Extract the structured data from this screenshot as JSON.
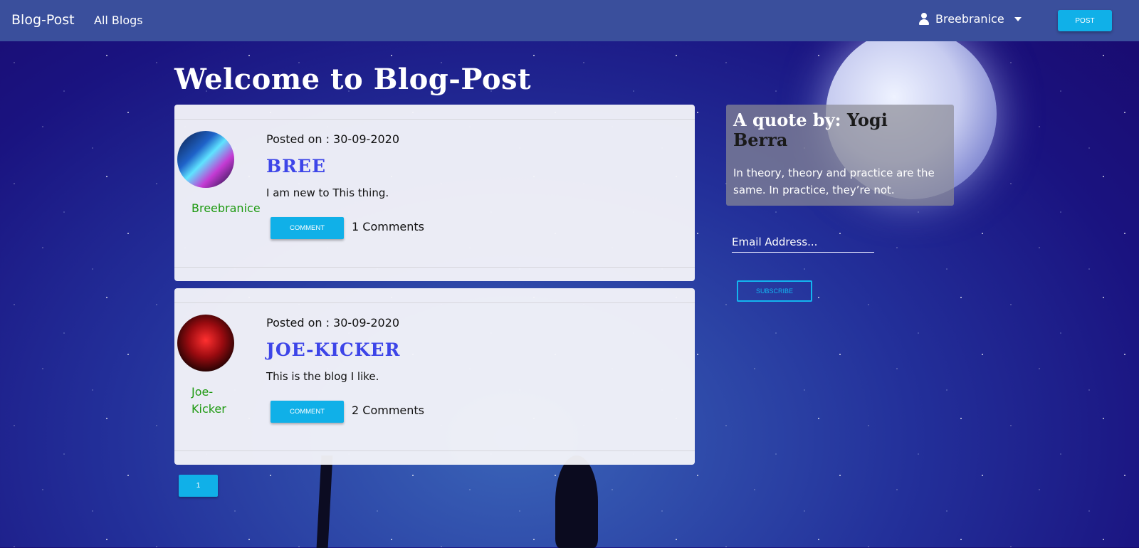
{
  "nav": {
    "brand": "Blog-Post",
    "all_blogs": "All Blogs",
    "user": "Breebranice",
    "post_button": "POST"
  },
  "main": {
    "title": "Welcome to Blog-Post"
  },
  "posts": [
    {
      "posted_on": "Posted on : 30-09-2020",
      "title": "BREE",
      "body": "I am new to This thing.",
      "author": "Breebranice",
      "comment_button": "COMMENT",
      "comments": "1 Comments"
    },
    {
      "posted_on": "Posted on : 30-09-2020",
      "title": "JOE-KICKER",
      "body": "This is the blog I like.",
      "author": "Joe-Kicker",
      "comment_button": "COMMENT",
      "comments": "2 Comments"
    }
  ],
  "sidebar": {
    "quote_prefix": "A quote by: ",
    "quote_author": "Yogi Berra",
    "quote_text": "In theory, theory and practice are the same. In practice, they’re not.",
    "email_placeholder": "Email Address...",
    "subscribe_button": "SUBSCRIBE"
  },
  "pagination": {
    "current_page": "1"
  },
  "colors": {
    "navbar": "#3a4f9c",
    "accent": "#10b0e8",
    "post_title": "#3d45e8",
    "author": "#1f9a12"
  }
}
